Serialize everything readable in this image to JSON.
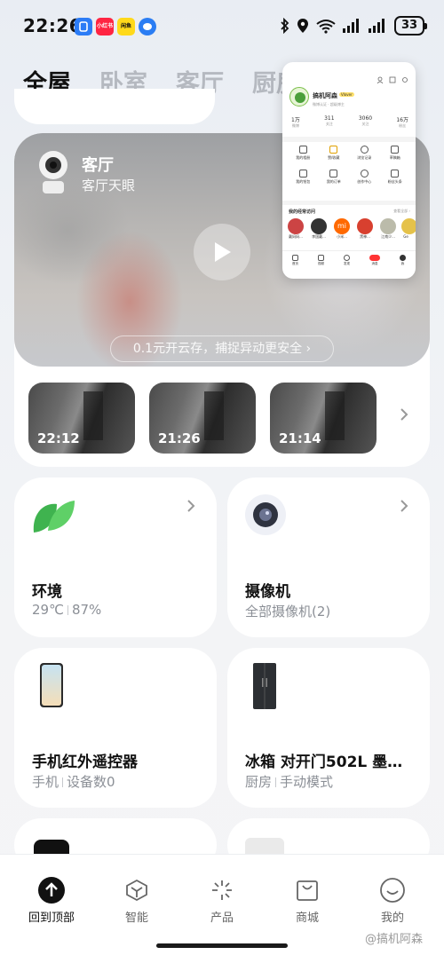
{
  "status_bar": {
    "time": "22:26",
    "app_badges": [
      {
        "label": "",
        "color": "#2c7cf6"
      },
      {
        "label": "小红书",
        "color": "#ff2442"
      },
      {
        "label": "闲鱼",
        "color": "#ffd91a"
      },
      {
        "label": "",
        "color": "#2b7df3"
      }
    ],
    "battery": "33"
  },
  "tabs": [
    "全屋",
    "卧室",
    "客厅",
    "厨房"
  ],
  "camera": {
    "room": "客厅",
    "device": "客厅天眼",
    "cloud_tip": "0.1元开云存，捕捉异动更安全 ›",
    "clips": [
      "22:12",
      "21:26",
      "21:14"
    ]
  },
  "devices": [
    {
      "name": "环境",
      "status": [
        "29℃",
        "87%"
      ],
      "icon": "leaf-icon"
    },
    {
      "name": "摄像机",
      "status": [
        "全部摄像机(2)"
      ],
      "icon": "camera-icon"
    },
    {
      "name": "手机红外遥控器",
      "status": [
        "手机",
        "设备数0"
      ],
      "icon": "phone-icon"
    },
    {
      "name": "冰箱 对开门502L 墨…",
      "status": [
        "厨房",
        "手动模式"
      ],
      "icon": "fridge-icon"
    }
  ],
  "popup": {
    "username": "搞机阿森",
    "level": "Vlover",
    "sub": "微博认证 · 超级博主",
    "stats": [
      {
        "value": "1万",
        "label": "微博"
      },
      {
        "value": "311",
        "label": "关注"
      },
      {
        "value": "3060",
        "label": "关注"
      },
      {
        "value": "16万",
        "label": "粉丝"
      }
    ],
    "menu": [
      "我的相册",
      "赞/收藏",
      "浏览记录",
      "草稿箱",
      "我的钱包",
      "我的订单",
      "创作中心",
      "粉丝头条"
    ],
    "recent_title": "我的经常访问",
    "recent_more": "查看全部 ›",
    "recent": [
      "戴妈妈...",
      "李国戴...",
      "小米...",
      "黑神...",
      "江南少...",
      "Ge"
    ],
    "tabbar": [
      "首页",
      "视频",
      "发现",
      "消息",
      "我"
    ]
  },
  "bottom_nav": [
    {
      "label": "回到顶部",
      "icon": "arrow-up-icon"
    },
    {
      "label": "智能",
      "icon": "cube-icon"
    },
    {
      "label": "产品",
      "icon": "sparkle-icon"
    },
    {
      "label": "商城",
      "icon": "bag-icon"
    },
    {
      "label": "我的",
      "icon": "smile-icon"
    }
  ],
  "watermark": "@搞机阿森"
}
